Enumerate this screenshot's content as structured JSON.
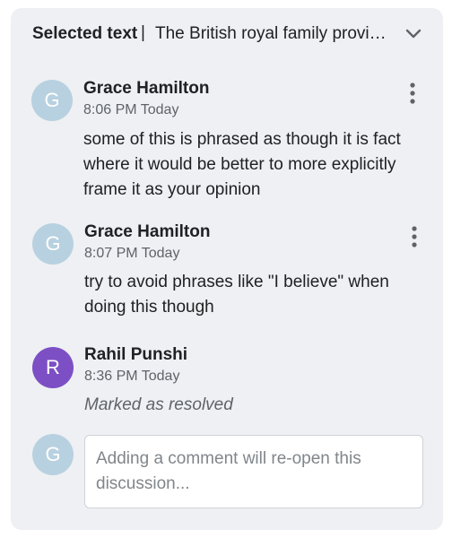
{
  "header": {
    "label": "Selected text",
    "separator": "|",
    "quote": "The British royal family provides",
    "collapse_icon": "chevron-down-icon"
  },
  "comments": [
    {
      "avatar_letter": "G",
      "avatar_color": "#b8d1e0",
      "author": "Grace Hamilton",
      "time": "8:06 PM Today",
      "text": "some of this is phrased as though it is fact where it would be better to more explicitly frame it as your opinion"
    },
    {
      "avatar_letter": "G",
      "avatar_color": "#b8d1e0",
      "author": "Grace Hamilton",
      "time": "8:07 PM Today",
      "text": "try to avoid phrases like \"I believe\" when doing this though"
    },
    {
      "avatar_letter": "R",
      "avatar_color": "#7d4fc4",
      "author": "Rahil Punshi",
      "time": "8:36 PM Today",
      "text": "Marked as resolved"
    }
  ],
  "reply": {
    "avatar_letter": "G",
    "placeholder": "Adding a comment will re-open this discussion..."
  }
}
